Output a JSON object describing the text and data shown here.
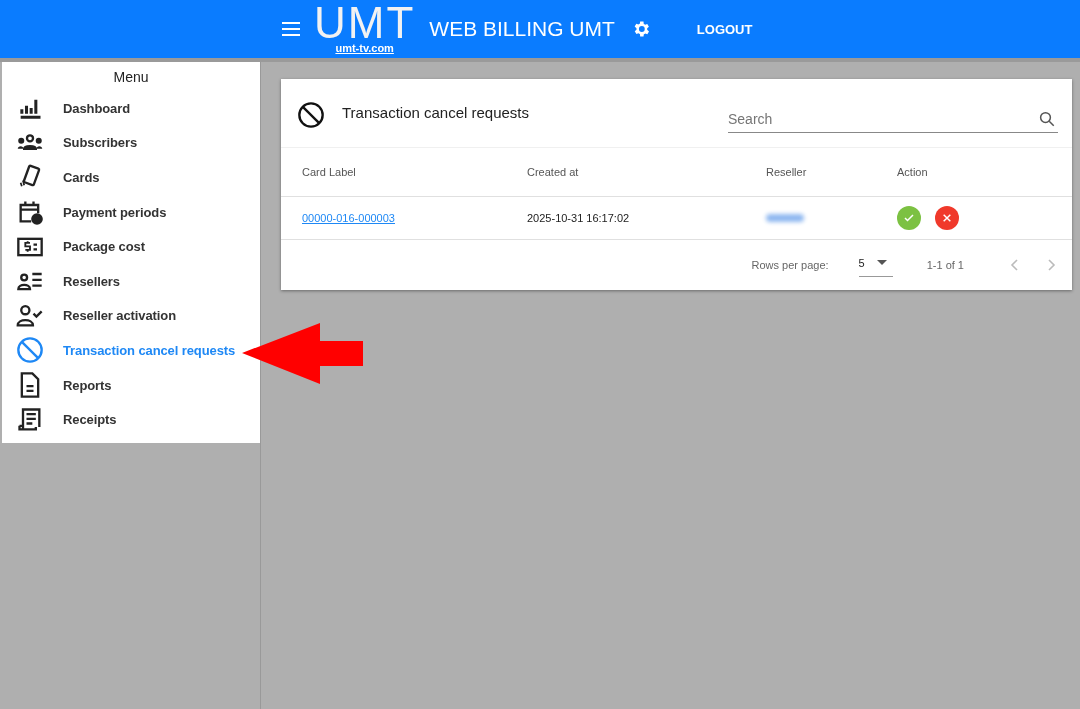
{
  "header": {
    "logo": {
      "letters": "UMT",
      "domain": "umt-tv.com"
    },
    "title": "WEB BILLING UMT",
    "logout": "LOGOUT"
  },
  "sidebar": {
    "heading": "Menu",
    "items": [
      {
        "label": "Dashboard",
        "selected": false
      },
      {
        "label": "Subscribers",
        "selected": false
      },
      {
        "label": "Cards",
        "selected": false
      },
      {
        "label": "Payment periods",
        "selected": false
      },
      {
        "label": "Package cost",
        "selected": false
      },
      {
        "label": "Resellers",
        "selected": false
      },
      {
        "label": "Reseller activation",
        "selected": false
      },
      {
        "label": "Transaction cancel requests",
        "selected": true
      },
      {
        "label": "Reports",
        "selected": false
      },
      {
        "label": "Receipts",
        "selected": false
      }
    ]
  },
  "panel": {
    "title": "Transaction cancel requests",
    "search": {
      "placeholder": "Search"
    },
    "table": {
      "columns": [
        "Card Label",
        "Created at",
        "Reseller",
        "Action"
      ],
      "rows": [
        {
          "card_label": "00000-016-000003",
          "created_at": "2025-10-31 16:17:02"
        }
      ]
    },
    "pagination": {
      "rows_per_page_label": "Rows per page:",
      "rows_per_page": "5",
      "range": "1-1 of 1"
    }
  }
}
